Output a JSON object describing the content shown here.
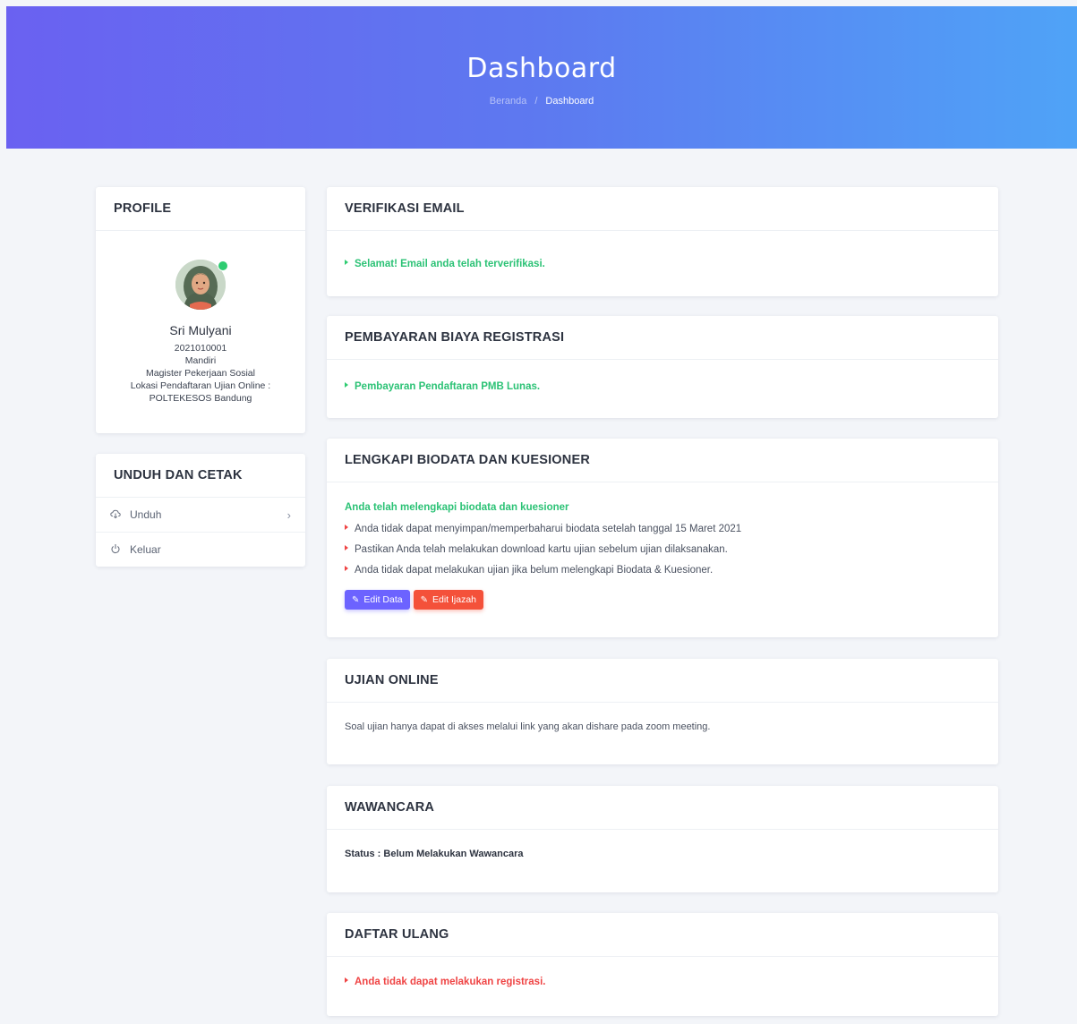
{
  "header": {
    "title": "Dashboard",
    "breadcrumb_home": "Beranda",
    "breadcrumb_sep": "/",
    "breadcrumb_current": "Dashboard"
  },
  "profile": {
    "heading": "PROFILE",
    "name": "Sri Mulyani",
    "id": "2021010001",
    "track": "Mandiri",
    "program": "Magister Pekerjaan Sosial",
    "location_label": "Lokasi Pendaftaran Ujian Online :",
    "location": "POLTEKESOS Bandung",
    "status": "online"
  },
  "downloads": {
    "heading": "UNDUH DAN CETAK",
    "items": [
      {
        "label": "Unduh",
        "icon": "cloud-download-icon"
      },
      {
        "label": "Keluar",
        "icon": "power-icon"
      }
    ]
  },
  "email": {
    "heading": "VERIFIKASI EMAIL",
    "message": "Selamat! Email anda telah terverifikasi."
  },
  "payment": {
    "heading": "PEMBAYARAN BIAYA REGISTRASI",
    "message": "Pembayaran Pendaftaran PMB Lunas."
  },
  "biodata": {
    "heading": "LENGKAPI BIODATA DAN KUESIONER",
    "complete": "Anda telah melengkapi biodata dan kuesioner",
    "notes": [
      "Anda tidak dapat menyimpan/memperbaharui biodata setelah tanggal 15 Maret 2021",
      "Pastikan Anda telah melakukan download kartu ujian sebelum ujian dilaksanakan.",
      "Anda tidak dapat melakukan ujian jika belum melengkapi Biodata & Kuesioner."
    ],
    "edit_data": "Edit Data",
    "edit_ijazah": "Edit Ijazah"
  },
  "exam": {
    "heading": "UJIAN ONLINE",
    "message": "Soal ujian hanya dapat di akses melalui link yang akan dishare pada zoom meeting."
  },
  "interview": {
    "heading": "WAWANCARA",
    "status": "Status : Belum Melakukan Wawancara"
  },
  "reregister": {
    "heading": "DAFTAR ULANG",
    "message": "Anda tidak dapat melakukan registrasi."
  },
  "colors": {
    "hero_start": "#6a61f1",
    "hero_end": "#4fa3f7",
    "success": "#2bc275",
    "danger": "#ef4444",
    "primary_button": "#6c63ff",
    "danger_button": "#f4513a"
  }
}
